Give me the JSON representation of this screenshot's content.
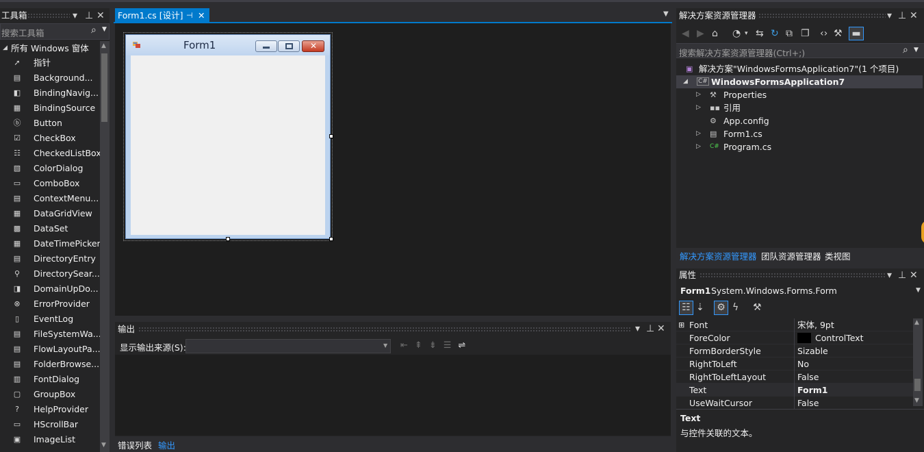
{
  "toolbox": {
    "title": "工具箱",
    "search_placeholder": "搜索工具箱",
    "group": "所有 Windows 窗体",
    "items": [
      {
        "label": "指针",
        "icon": "pointer-icon"
      },
      {
        "label": "Background...",
        "icon": "backgroundworker-icon"
      },
      {
        "label": "BindingNavig...",
        "icon": "bindingnavigator-icon"
      },
      {
        "label": "BindingSource",
        "icon": "bindingsource-icon"
      },
      {
        "label": "Button",
        "icon": "button-icon"
      },
      {
        "label": "CheckBox",
        "icon": "checkbox-icon"
      },
      {
        "label": "CheckedListBox",
        "icon": "checkedlistbox-icon"
      },
      {
        "label": "ColorDialog",
        "icon": "colordialog-icon"
      },
      {
        "label": "ComboBox",
        "icon": "combobox-icon"
      },
      {
        "label": "ContextMenu...",
        "icon": "contextmenu-icon"
      },
      {
        "label": "DataGridView",
        "icon": "datagridview-icon"
      },
      {
        "label": "DataSet",
        "icon": "dataset-icon"
      },
      {
        "label": "DateTimePicker",
        "icon": "datetimepicker-icon"
      },
      {
        "label": "DirectoryEntry",
        "icon": "directoryentry-icon"
      },
      {
        "label": "DirectorySear...",
        "icon": "directorysearcher-icon"
      },
      {
        "label": "DomainUpDo...",
        "icon": "domainupdown-icon"
      },
      {
        "label": "ErrorProvider",
        "icon": "errorprovider-icon"
      },
      {
        "label": "EventLog",
        "icon": "eventlog-icon"
      },
      {
        "label": "FileSystemWa...",
        "icon": "filesystemwatcher-icon"
      },
      {
        "label": "FlowLayoutPa...",
        "icon": "flowlayoutpanel-icon"
      },
      {
        "label": "FolderBrowse...",
        "icon": "folderbrowser-icon"
      },
      {
        "label": "FontDialog",
        "icon": "fontdialog-icon"
      },
      {
        "label": "GroupBox",
        "icon": "groupbox-icon"
      },
      {
        "label": "HelpProvider",
        "icon": "helpprovider-icon"
      },
      {
        "label": "HScrollBar",
        "icon": "hscrollbar-icon"
      },
      {
        "label": "ImageList",
        "icon": "imagelist-icon"
      }
    ]
  },
  "designer": {
    "tab_label": "Form1.cs [设计]",
    "form_title": "Form1"
  },
  "output": {
    "title": "输出",
    "source_label": "显示输出来源(S):",
    "tabs": [
      "错误列表",
      "输出"
    ]
  },
  "solution_explorer": {
    "title": "解决方案资源管理器",
    "search_placeholder": "搜索解决方案资源管理器(Ctrl+;)",
    "solution_label": "解决方案\"WindowsFormsApplication7\"(1 个项目)",
    "project": "WindowsFormsApplication7",
    "nodes": [
      {
        "label": "Properties",
        "icon": "wrench-icon",
        "expandable": true
      },
      {
        "label": "引用",
        "icon": "references-icon",
        "expandable": true
      },
      {
        "label": "App.config",
        "icon": "config-file-icon",
        "expandable": false
      },
      {
        "label": "Form1.cs",
        "icon": "form-file-icon",
        "expandable": true
      },
      {
        "label": "Program.cs",
        "icon": "csharp-file-icon",
        "expandable": true
      }
    ],
    "bottom_tabs": [
      "解决方案资源管理器",
      "团队资源管理器",
      "类视图"
    ]
  },
  "properties": {
    "title": "属性",
    "object_name": "Form1",
    "object_type": "System.Windows.Forms.Form",
    "rows": [
      {
        "name": "Font",
        "value": "宋体, 9pt",
        "expandable": true
      },
      {
        "name": "ForeColor",
        "value": "ControlText",
        "swatch": "#000000"
      },
      {
        "name": "FormBorderStyle",
        "value": "Sizable"
      },
      {
        "name": "RightToLeft",
        "value": "No"
      },
      {
        "name": "RightToLeftLayout",
        "value": "False"
      },
      {
        "name": "Text",
        "value": "Form1",
        "bold": true
      },
      {
        "name": "UseWaitCursor",
        "value": "False"
      }
    ],
    "desc_title": "Text",
    "desc_text": "与控件关联的文本。"
  },
  "colors": {
    "accent": "#007acc",
    "background": "#2d2d30",
    "panel": "#252526",
    "editor": "#1e1e1e"
  }
}
